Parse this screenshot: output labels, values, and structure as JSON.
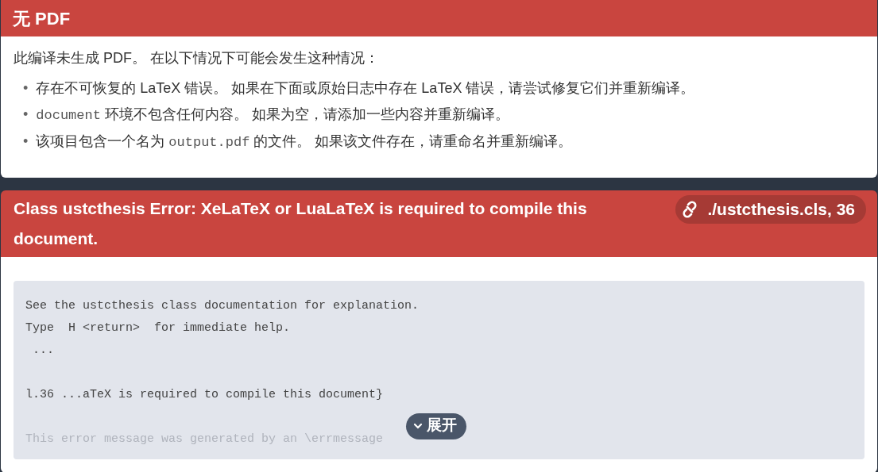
{
  "no_pdf": {
    "title": "无 PDF",
    "intro": "此编译未生成 PDF。 在以下情况下可能会发生这种情况：",
    "reasons": [
      {
        "bullet": "•",
        "segments": [
          {
            "text": "存在不可恢复的 LaTeX 错误。 如果在下面或原始日志中存在 LaTeX 错误，请尝试修复它们并重新编译。",
            "code": false
          }
        ]
      },
      {
        "bullet": "•",
        "segments": [
          {
            "text": "document",
            "code": true
          },
          {
            "text": " 环境不包含任何内容。 如果为空，请添加一些内容并重新编译。",
            "code": false
          }
        ]
      },
      {
        "bullet": "•",
        "segments": [
          {
            "text": "该项目包含一个名为 ",
            "code": false
          },
          {
            "text": "output.pdf",
            "code": true
          },
          {
            "text": " 的文件。 如果该文件存在，请重命名并重新编译。",
            "code": false
          }
        ]
      }
    ]
  },
  "error": {
    "title": "Class ustcthesis Error: XeLaTeX or LuaLaTeX is required to compile this document.",
    "location": "./ustcthesis.cls, 36",
    "log": [
      {
        "text": "See the ustcthesis class documentation for explanation.",
        "blank_before": false,
        "faded": false
      },
      {
        "text": "Type  H <return>  for immediate help.",
        "blank_before": false,
        "faded": false
      },
      {
        "text": " ...",
        "blank_before": false,
        "faded": false
      },
      {
        "text": "l.36 ...aTeX is required to compile this document}",
        "blank_before": true,
        "faded": false
      },
      {
        "text": "This error message was generated by an \\errmessage",
        "blank_before": true,
        "faded": true
      }
    ],
    "expand_label": "展开"
  }
}
